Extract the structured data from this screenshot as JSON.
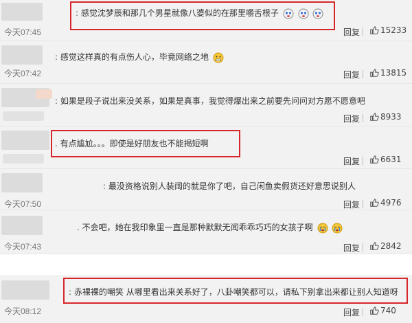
{
  "comments": [
    {
      "text": "感觉沈梦辰和那几个男星就像八婆似的在那里嚼舌根子",
      "prefix": ":",
      "time": "今天07:45",
      "reply": "回复",
      "likes": "15233",
      "emojis": [
        "crying-face-icon",
        "crying-face-icon",
        "crying-face-icon"
      ]
    },
    {
      "text": "感觉这样真的有点伤人心，毕竟网络之地",
      "prefix": ":",
      "time": "今天07:42",
      "reply": "回复",
      "likes": "13815",
      "emojis": [
        "grimace-face-icon"
      ]
    },
    {
      "text": "如果是段子说出来没关系，如果是真事，我觉得爆出来之前要先问问对方愿不愿意吧",
      "prefix": ":",
      "time": "",
      "reply": "回复",
      "likes": "8933",
      "emojis": []
    },
    {
      "text": "有点尴尬。。。即使是好朋友也不能揭短啊",
      "prefix": ".",
      "time": "",
      "reply": "回复",
      "likes": "6631",
      "emojis": []
    },
    {
      "text": "最没资格说别人装阔的就是你了吧，自己闲鱼卖假货还好意思说别人",
      "prefix": ":",
      "time": "今天07:50",
      "reply": "回复",
      "likes": "4976",
      "emojis": []
    },
    {
      "text": "不会吧，她在我印象里一直是那种默默无闻乖乖巧巧的女孩子啊",
      "prefix": ".",
      "time": "今天07:43",
      "reply": "回复",
      "likes": "2842",
      "emojis": [
        "crying-face-icon",
        "crying-face-icon"
      ]
    },
    {
      "text": "赤裸裸的嘲笑 从哪里看出来关系好了，八卦嘲笑都可以，请私下别拿出来都让别人知道呀",
      "prefix": ":",
      "time": "今天08:12",
      "reply": "回复",
      "likes": "740",
      "emojis": []
    }
  ]
}
